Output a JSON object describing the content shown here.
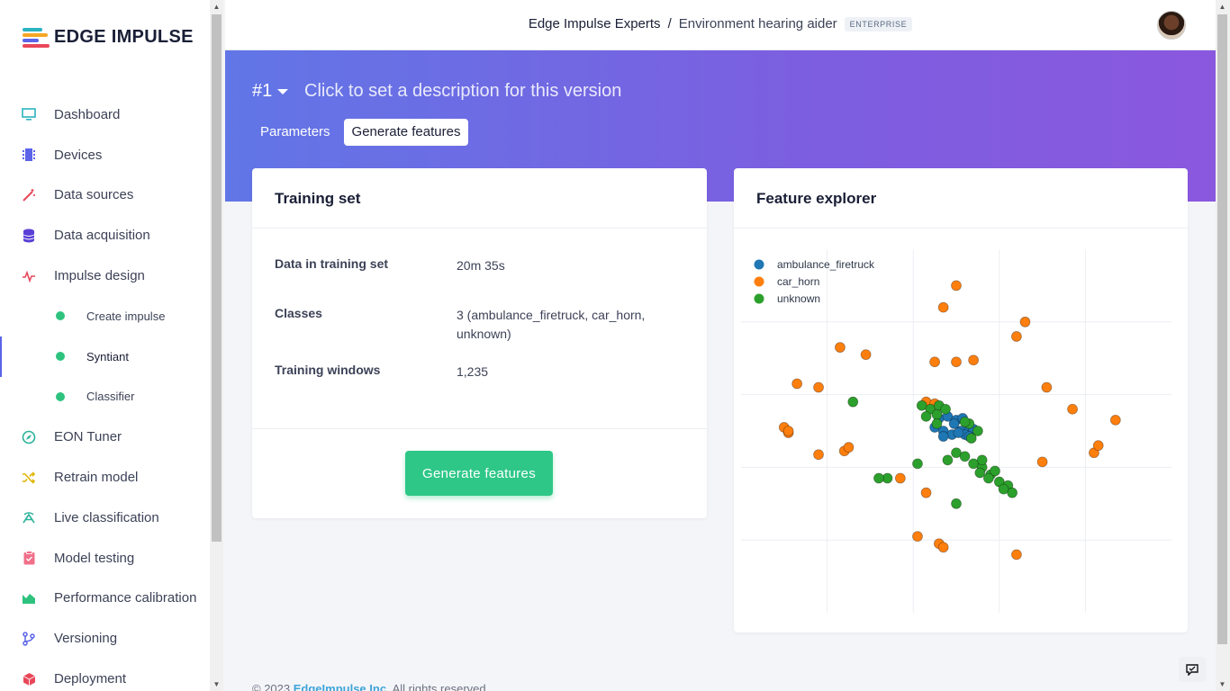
{
  "brand": {
    "name": "EDGE IMPULSE"
  },
  "sidebar": {
    "items": [
      {
        "label": "Dashboard",
        "icon": "monitor-icon",
        "color": "#2bb3c0",
        "sub": false
      },
      {
        "label": "Devices",
        "icon": "chip-icon",
        "color": "#5b64e8",
        "sub": false
      },
      {
        "label": "Data sources",
        "icon": "wand-icon",
        "color": "#e8475a",
        "sub": false
      },
      {
        "label": "Data acquisition",
        "icon": "database-icon",
        "color": "#5a3fd6",
        "sub": false
      },
      {
        "label": "Impulse design",
        "icon": "pulse-icon",
        "color": "#e8475a",
        "sub": false
      },
      {
        "label": "Create impulse",
        "icon": "dot-icon",
        "color": "#2ec27e",
        "sub": true
      },
      {
        "label": "Syntiant",
        "icon": "dot-icon",
        "color": "#2ec27e",
        "sub": true,
        "active": true
      },
      {
        "label": "Classifier",
        "icon": "dot-icon",
        "color": "#2ec27e",
        "sub": true
      },
      {
        "label": "EON Tuner",
        "icon": "compass-icon",
        "color": "#2bb39a",
        "sub": false
      },
      {
        "label": "Retrain model",
        "icon": "shuffle-icon",
        "color": "#e0b400",
        "sub": false
      },
      {
        "label": "Live classification",
        "icon": "signal-icon",
        "color": "#2bb39a",
        "sub": false
      },
      {
        "label": "Model testing",
        "icon": "clipboard-icon",
        "color": "#f0708a",
        "sub": false
      },
      {
        "label": "Performance calibration",
        "icon": "chart-area-icon",
        "color": "#2ec27e",
        "sub": false
      },
      {
        "label": "Versioning",
        "icon": "branch-icon",
        "color": "#5b64e8",
        "sub": false
      },
      {
        "label": "Deployment",
        "icon": "box-icon",
        "color": "#e8475a",
        "sub": false
      }
    ]
  },
  "topbar": {
    "org": "Edge Impulse Experts",
    "separator": "/",
    "project": "Environment hearing aider",
    "badge": "ENTERPRISE"
  },
  "hero": {
    "version": "#1",
    "description_placeholder": "Click to set a description for this version",
    "tabs": [
      {
        "label": "Parameters",
        "active": false
      },
      {
        "label": "Generate features",
        "active": true
      }
    ]
  },
  "training_set": {
    "title": "Training set",
    "rows": [
      {
        "key": "Data in training set",
        "value": "20m 35s"
      },
      {
        "key": "Classes",
        "value": "3 (ambulance_firetruck, car_horn, unknown)"
      },
      {
        "key": "Training windows",
        "value": "1,235"
      }
    ],
    "button": "Generate features"
  },
  "feature_explorer": {
    "title": "Feature explorer"
  },
  "chart_data": {
    "type": "scatter",
    "title": "",
    "xlabel": "",
    "ylabel": "",
    "grid": true,
    "legend": "top-left",
    "xlim": [
      -4,
      6
    ],
    "ylim": [
      -5,
      5
    ],
    "series": [
      {
        "name": "ambulance_firetruck",
        "color": "#1f77b4",
        "points": [
          [
            0.5,
            0.1
          ],
          [
            0.7,
            0.0
          ],
          [
            0.9,
            -0.1
          ],
          [
            1.1,
            0.0
          ],
          [
            1.3,
            0.1
          ],
          [
            0.6,
            0.35
          ],
          [
            0.8,
            0.4
          ],
          [
            1.0,
            0.3
          ],
          [
            1.2,
            -0.1
          ],
          [
            1.4,
            0.05
          ],
          [
            0.95,
            0.2
          ],
          [
            1.15,
            0.35
          ],
          [
            0.7,
            -0.15
          ],
          [
            1.05,
            -0.05
          ],
          [
            1.3,
            -0.15
          ]
        ]
      },
      {
        "name": "car_horn",
        "color": "#ff7f0e",
        "points": [
          [
            1.0,
            4.0
          ],
          [
            0.7,
            3.4
          ],
          [
            2.6,
            3.0
          ],
          [
            2.4,
            2.6
          ],
          [
            -1.7,
            2.3
          ],
          [
            -1.1,
            2.1
          ],
          [
            0.5,
            1.9
          ],
          [
            1.0,
            1.9
          ],
          [
            1.4,
            1.95
          ],
          [
            -2.7,
            1.3
          ],
          [
            -2.2,
            1.2
          ],
          [
            3.1,
            1.2
          ],
          [
            3.7,
            0.6
          ],
          [
            4.7,
            0.3
          ],
          [
            -3.0,
            0.1
          ],
          [
            -2.9,
            -0.05
          ],
          [
            -2.9,
            0.0
          ],
          [
            -2.2,
            -0.65
          ],
          [
            -1.6,
            -0.55
          ],
          [
            -1.5,
            -0.45
          ],
          [
            3.0,
            -0.85
          ],
          [
            4.2,
            -0.6
          ],
          [
            4.3,
            -0.4
          ],
          [
            -0.3,
            -1.3
          ],
          [
            0.3,
            -1.7
          ],
          [
            0.1,
            -2.9
          ],
          [
            0.6,
            -3.1
          ],
          [
            0.7,
            -3.2
          ],
          [
            2.4,
            -3.4
          ],
          [
            0.3,
            0.8
          ],
          [
            0.5,
            0.75
          ]
        ]
      },
      {
        "name": "unknown",
        "color": "#2ca02c",
        "points": [
          [
            -1.4,
            0.8
          ],
          [
            0.2,
            0.7
          ],
          [
            0.4,
            0.6
          ],
          [
            0.6,
            0.7
          ],
          [
            0.3,
            0.4
          ],
          [
            0.55,
            0.45
          ],
          [
            1.3,
            0.2
          ],
          [
            1.5,
            0.0
          ],
          [
            1.35,
            -0.2
          ],
          [
            0.8,
            -0.8
          ],
          [
            1.0,
            -0.6
          ],
          [
            1.2,
            -0.7
          ],
          [
            1.4,
            -0.9
          ],
          [
            1.6,
            -1.0
          ],
          [
            1.8,
            -1.2
          ],
          [
            2.0,
            -1.4
          ],
          [
            2.2,
            -1.5
          ],
          [
            2.3,
            -1.7
          ],
          [
            1.6,
            -0.8
          ],
          [
            1.9,
            -1.1
          ],
          [
            2.1,
            -1.6
          ],
          [
            0.1,
            -0.9
          ],
          [
            -0.6,
            -1.3
          ],
          [
            -0.8,
            -1.3
          ],
          [
            1.0,
            -2.0
          ],
          [
            1.55,
            -1.15
          ],
          [
            1.75,
            -1.3
          ],
          [
            0.55,
            0.2
          ],
          [
            0.75,
            0.6
          ],
          [
            1.2,
            0.25
          ]
        ]
      }
    ]
  },
  "footer": {
    "prefix": "© 2023",
    "link": "EdgeImpulse Inc.",
    "suffix": "All rights reserved"
  },
  "feedback": {
    "icon": "feedback-icon"
  }
}
